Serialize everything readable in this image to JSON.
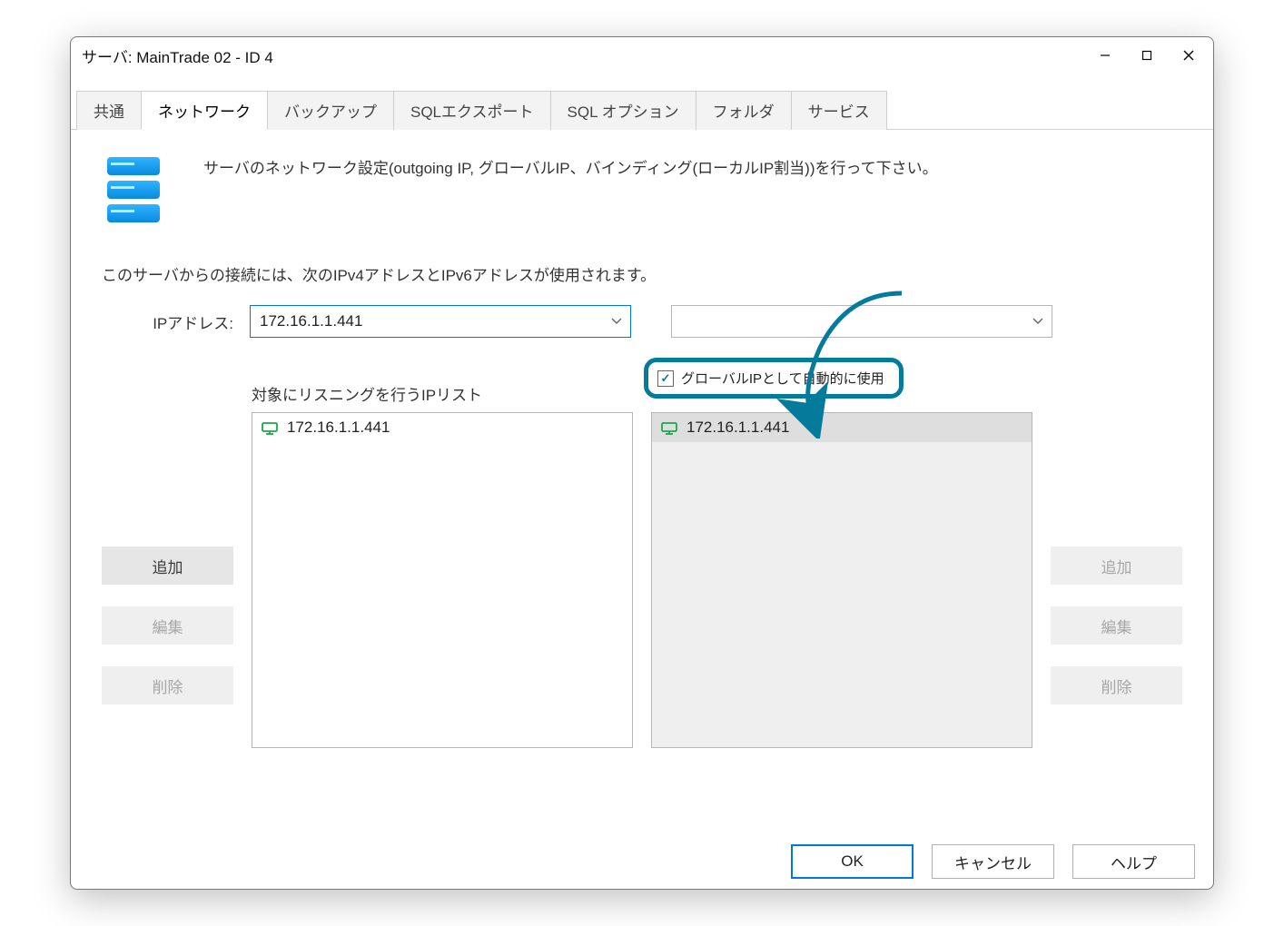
{
  "window": {
    "title": "サーバ: MainTrade 02 - ID 4"
  },
  "tabs": {
    "common": "共通",
    "network": "ネットワーク",
    "backup": "バックアップ",
    "sqlexport": "SQLエクスポート",
    "sqloptions": "SQL オプション",
    "folder": "フォルダ",
    "service": "サービス"
  },
  "header": {
    "description": "サーバのネットワーク設定(outgoing IP, グローバルIP、バインディング(ローカルIP割当))を行って下さい。"
  },
  "subhead": "このサーバからの接続には、次のIPv4アドレスとIPv6アドレスが使用されます。",
  "ipRow": {
    "label": "IPアドレス:",
    "value1": "172.16.1.1.441",
    "value2": ""
  },
  "leftColumn": {
    "label": "対象にリスニングを行うIPリスト",
    "items": [
      "172.16.1.1.441"
    ]
  },
  "rightColumn": {
    "checkboxLabel": "グローバルIPとして自動的に使用",
    "checkboxChecked": true,
    "items": [
      "172.16.1.1.441"
    ]
  },
  "sideButtons": {
    "add": "追加",
    "edit": "編集",
    "delete": "削除"
  },
  "footer": {
    "ok": "OK",
    "cancel": "キャンセル",
    "help": "ヘルプ"
  }
}
